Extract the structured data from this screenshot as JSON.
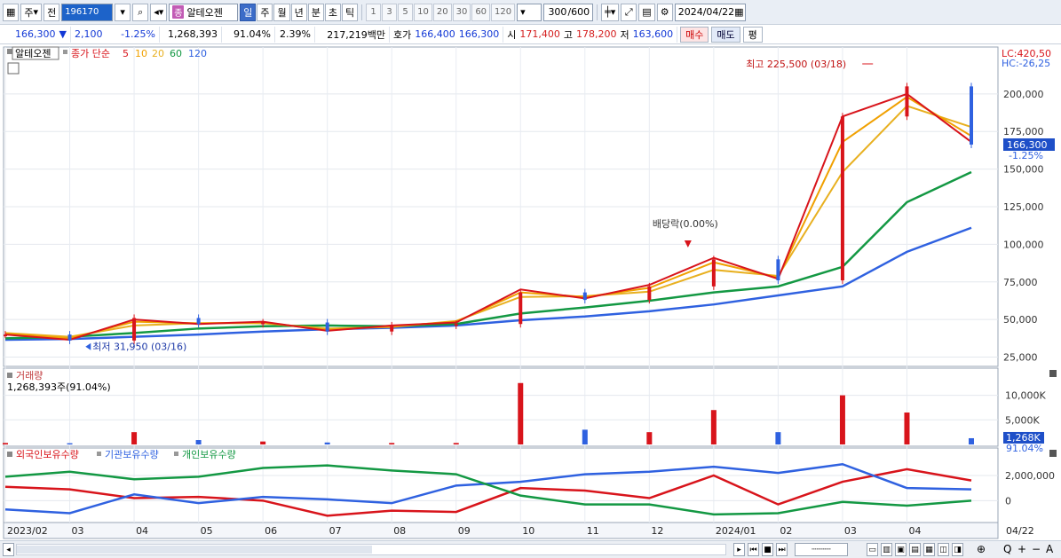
{
  "toolbar": {
    "type_label": "주",
    "prev_label": "전",
    "code": "196170",
    "badge": "종",
    "name": "알테오젠",
    "period_buttons": [
      "일",
      "주",
      "월",
      "년",
      "분",
      "초",
      "틱"
    ],
    "active_period": "일",
    "num_buttons": [
      "1",
      "3",
      "5",
      "10",
      "20",
      "30",
      "60",
      "120"
    ],
    "count": "300",
    "count_total": "/600",
    "date": "2024/04/22"
  },
  "pricebar": {
    "price": "166,300",
    "change": "2,100",
    "change_pct": "-1.25%",
    "volume": "1,268,393",
    "volume_ratio": "91.04%",
    "turnover": "2.39%",
    "amount": "217,219백만",
    "hoga_label": "호가",
    "ask": "166,400",
    "bid": "166,300",
    "open_label": "시",
    "open": "171,400",
    "high_label": "고",
    "high": "178,200",
    "low_label": "저",
    "low": "163,600",
    "buy_label": "매수",
    "sell_label": "매도",
    "eval_label": "평"
  },
  "price_panel": {
    "stock_name": "알테오젠",
    "ma_prefix": "종가 단순",
    "ma_periods": [
      "5",
      "10",
      "20",
      "60",
      "120"
    ],
    "ma_colors": [
      "#d8141b",
      "#f0a000",
      "#e8b020",
      "#139843",
      "#2f61e0"
    ],
    "lc": "LC:420,50",
    "hc": "HC:-26,25",
    "high_marker": "최고 225,500 (03/18)",
    "low_marker": "최저 31,950 (03/16)",
    "dividend_marker": "배당락(0.00%)",
    "last_price": "166,300",
    "last_pct": "-1.25%",
    "y_ticks": [
      "200,000",
      "175,000",
      "150,000",
      "125,000",
      "100,000",
      "75,000",
      "50,000",
      "25,000"
    ]
  },
  "volume_panel": {
    "title": "거래량",
    "subtitle": "1,268,393주(91.04%)",
    "y_ticks": [
      "10,000K",
      "5,000K"
    ],
    "last_value": "1,268K",
    "last_pct": "91.04%"
  },
  "flow_panel": {
    "legend": [
      "외국인보유수량",
      "기관보유수량",
      "개인보유수량"
    ],
    "legend_colors": [
      "#d8141b",
      "#2f61e0",
      "#139843"
    ],
    "y_ticks": [
      "2,000,000",
      "0"
    ]
  },
  "x_axis": {
    "labels": [
      "2023/02",
      "03",
      "04",
      "05",
      "06",
      "07",
      "08",
      "09",
      "10",
      "11",
      "12",
      "2024/01",
      "02",
      "03",
      "04"
    ],
    "last_date": "04/22"
  },
  "chart_data": {
    "type": "candlestick",
    "title": "알테오젠",
    "x": [
      "2023/02",
      "03",
      "04",
      "05",
      "06",
      "07",
      "08",
      "09",
      "10",
      "11",
      "12",
      "2024/01",
      "02",
      "03",
      "04",
      "04/22"
    ],
    "close": [
      40000,
      36000,
      51000,
      47000,
      48000,
      42000,
      46000,
      47000,
      68000,
      63000,
      72000,
      90000,
      76000,
      185000,
      205000,
      166300
    ],
    "series": [
      {
        "name": "5",
        "values": [
          40000,
          36500,
          50000,
          47000,
          48500,
          42500,
          46000,
          48000,
          70000,
          64000,
          73000,
          91000,
          77000,
          185000,
          200000,
          168000
        ]
      },
      {
        "name": "10",
        "values": [
          40500,
          37500,
          48500,
          47500,
          48000,
          43000,
          45500,
          48500,
          68000,
          65000,
          71000,
          88000,
          78000,
          168000,
          198000,
          172000
        ]
      },
      {
        "name": "20",
        "values": [
          41000,
          38500,
          46000,
          47500,
          47500,
          44000,
          45000,
          49000,
          65000,
          65500,
          68500,
          83000,
          79000,
          148000,
          192000,
          178000
        ]
      },
      {
        "name": "60",
        "values": [
          37500,
          38500,
          41000,
          44000,
          45500,
          46000,
          45500,
          47000,
          54000,
          58000,
          62500,
          68000,
          72000,
          85000,
          128000,
          148000
        ]
      },
      {
        "name": "120",
        "values": [
          36500,
          37000,
          38500,
          40000,
          42000,
          43500,
          44500,
          46000,
          49500,
          52000,
          55500,
          60000,
          66000,
          72000,
          95000,
          111000
        ]
      }
    ],
    "volume_k": [
      300,
      250,
      2500,
      900,
      600,
      400,
      300,
      300,
      12500,
      3000,
      2500,
      7000,
      2500,
      10000,
      6500,
      1268
    ],
    "holdings": [
      {
        "name": "외국인보유수량",
        "values": [
          1100000,
          900000,
          200000,
          300000,
          0,
          -1200000,
          -800000,
          -900000,
          1000000,
          800000,
          200000,
          2000000,
          -300000,
          1500000,
          2500000,
          1600000
        ]
      },
      {
        "name": "기관보유수량",
        "values": [
          -700000,
          -1000000,
          500000,
          -200000,
          300000,
          100000,
          -200000,
          1200000,
          1500000,
          2100000,
          2300000,
          2700000,
          2200000,
          2900000,
          1000000,
          900000
        ]
      },
      {
        "name": "개인보유수량",
        "values": [
          1900000,
          2300000,
          1700000,
          1900000,
          2600000,
          2800000,
          2400000,
          2100000,
          400000,
          -300000,
          -300000,
          -1100000,
          -1000000,
          -100000,
          -400000,
          0
        ]
      }
    ],
    "ylim": [
      20000,
      230000
    ]
  }
}
